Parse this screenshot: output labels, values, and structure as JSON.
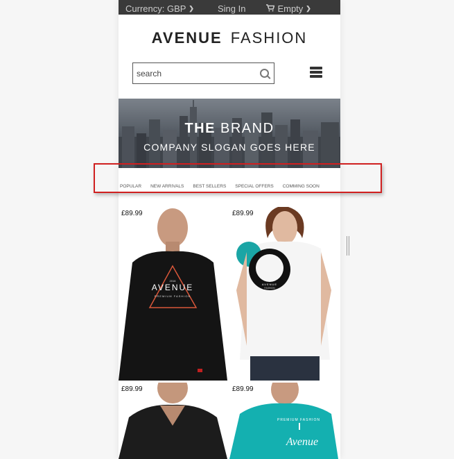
{
  "topbar": {
    "currency_label": "Currency: GBP",
    "signin_label": "Sing In",
    "cart_label": "Empty"
  },
  "logo": {
    "bold": "AVENUE",
    "light": "FASHION"
  },
  "search": {
    "placeholder": "search"
  },
  "banner": {
    "title_bold": "THE",
    "title_light": "BRAND",
    "slogan": "COMPANY SLOGAN GOES HERE"
  },
  "nav": {
    "items": [
      {
        "label": "POPULAR"
      },
      {
        "label": "NEW ARRIVALS"
      },
      {
        "label": "BEST SELLERS"
      },
      {
        "label": "SPECIAL OFFERS"
      },
      {
        "label": "COMMING SOON"
      }
    ]
  },
  "products": [
    {
      "price": "£89.99",
      "print": "AVENUE",
      "print_sub": "PREMIUM FASHION",
      "print_top": "2016",
      "shirt_color": "#141414"
    },
    {
      "price": "£89.99",
      "print": "AVENUE",
      "print_sub": "FASHION",
      "shirt_color": "#ffffff",
      "accent": "#1aa5a5"
    },
    {
      "price": "£89.99",
      "shirt_color": "#1c1c1c"
    },
    {
      "price": "£89.99",
      "print": "Avenue",
      "print_sub": "PREMIUM FASHION",
      "shirt_color": "#14b0b0"
    }
  ],
  "colors": {
    "highlight": "#d02020",
    "topbar": "#3a3a3a"
  }
}
